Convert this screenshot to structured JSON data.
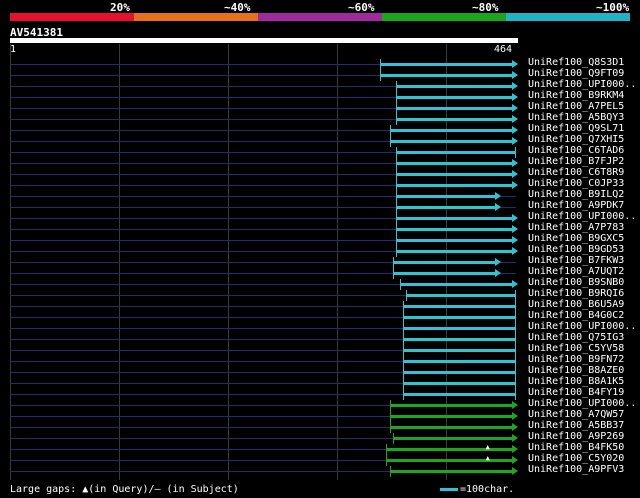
{
  "legend": {
    "segments": [
      {
        "label": "20%",
        "color": "#e8102f"
      },
      {
        "label": "~40%",
        "color": "#e8701a"
      },
      {
        "label": "~60%",
        "color": "#9e2a9e"
      },
      {
        "label": "~80%",
        "color": "#1aa51a"
      },
      {
        "label": "~100%",
        "color": "#1eb4c6"
      }
    ]
  },
  "query": {
    "name": "AV541381",
    "start": "1",
    "end": "464"
  },
  "hits": [
    {
      "label": "UniRef100_Q8S3D1",
      "start": 0.731,
      "color": "#2fc4d4",
      "arrow": true,
      "tick": true
    },
    {
      "label": "UniRef100_Q9FT09",
      "start": 0.731,
      "color": "#2fc4d4",
      "arrow": true,
      "tick": true
    },
    {
      "label": "UniRef100_UPI000..",
      "start": 0.762,
      "color": "#2fc4d4",
      "arrow": true,
      "tick": true
    },
    {
      "label": "UniRef100_B9RKM4",
      "start": 0.762,
      "color": "#2fc4d4",
      "arrow": true,
      "tick": true
    },
    {
      "label": "UniRef100_A7PEL5",
      "start": 0.762,
      "color": "#2fc4d4",
      "arrow": true,
      "tick": true
    },
    {
      "label": "UniRef100_A5BQY3",
      "start": 0.762,
      "color": "#2fc4d4",
      "arrow": true,
      "tick": true
    },
    {
      "label": "UniRef100_Q9SL71",
      "start": 0.75,
      "color": "#2fc4d4",
      "arrow": true,
      "tick": true
    },
    {
      "label": "UniRef100_Q7XHI5",
      "start": 0.75,
      "color": "#2fc4d4",
      "arrow": true,
      "tick": true
    },
    {
      "label": "UniRef100_C6TAD6",
      "start": 0.762,
      "color": "#2fc4d4",
      "arrow": false,
      "tick": true
    },
    {
      "label": "UniRef100_B7FJP2",
      "start": 0.762,
      "color": "#2fc4d4",
      "arrow": true,
      "tick": true
    },
    {
      "label": "UniRef100_C6T8R9",
      "start": 0.762,
      "color": "#2fc4d4",
      "arrow": true,
      "tick": true
    },
    {
      "label": "UniRef100_C0JP33",
      "start": 0.762,
      "color": "#2fc4d4",
      "arrow": true,
      "tick": true
    },
    {
      "label": "UniRef100_B9ILQ2",
      "start": 0.762,
      "end": 0.966,
      "color": "#2fc4d4",
      "arrow": true,
      "tick": true
    },
    {
      "label": "UniRef100_A9PDK7",
      "start": 0.762,
      "end": 0.966,
      "color": "#2fc4d4",
      "arrow": true,
      "tick": true
    },
    {
      "label": "UniRef100_UPI000..",
      "start": 0.762,
      "color": "#2fc4d4",
      "arrow": true,
      "tick": true
    },
    {
      "label": "UniRef100_A7P783",
      "start": 0.762,
      "color": "#2fc4d4",
      "arrow": true,
      "tick": true
    },
    {
      "label": "UniRef100_B9GXC5",
      "start": 0.762,
      "color": "#2fc4d4",
      "arrow": true,
      "tick": true
    },
    {
      "label": "UniRef100_B9GD53",
      "start": 0.762,
      "color": "#2fc4d4",
      "arrow": true,
      "tick": true
    },
    {
      "label": "UniRef100_B7FKW3",
      "start": 0.756,
      "end": 0.966,
      "color": "#2fc4d4",
      "arrow": true,
      "tick": true
    },
    {
      "label": "UniRef100_A7UQT2",
      "start": 0.756,
      "end": 0.966,
      "color": "#2fc4d4",
      "arrow": true,
      "tick": true
    },
    {
      "label": "UniRef100_B9SNB0",
      "start": 0.77,
      "color": "#2fc4d4",
      "arrow": true,
      "tick": true
    },
    {
      "label": "UniRef100_B9RQI6",
      "start": 0.782,
      "color": "#2fc4d4",
      "arrow": false,
      "tick": true
    },
    {
      "label": "UniRef100_B6U5A9",
      "start": 0.776,
      "color": "#2fc4d4",
      "arrow": false,
      "tick": true
    },
    {
      "label": "UniRef100_B4G0C2",
      "start": 0.776,
      "color": "#2fc4d4",
      "arrow": false,
      "tick": true
    },
    {
      "label": "UniRef100_UPI000..",
      "start": 0.776,
      "color": "#2fc4d4",
      "arrow": false,
      "tick": true
    },
    {
      "label": "UniRef100_Q75IG3",
      "start": 0.776,
      "color": "#2fc4d4",
      "arrow": false,
      "tick": true
    },
    {
      "label": "UniRef100_C5YV58",
      "start": 0.776,
      "color": "#2fc4d4",
      "arrow": false,
      "tick": true
    },
    {
      "label": "UniRef100_B9FN72",
      "start": 0.776,
      "color": "#2fc4d4",
      "arrow": false,
      "tick": true
    },
    {
      "label": "UniRef100_B8AZE0",
      "start": 0.776,
      "color": "#2fc4d4",
      "arrow": false,
      "tick": true
    },
    {
      "label": "UniRef100_B8A1K5",
      "start": 0.776,
      "color": "#2fc4d4",
      "arrow": false,
      "tick": true
    },
    {
      "label": "UniRef100_B4FY19",
      "start": 0.776,
      "color": "#2fc4d4",
      "arrow": false,
      "tick": true
    },
    {
      "label": "UniRef100_UPI000..",
      "start": 0.75,
      "color": "#1ea61e",
      "arrow": true,
      "tick": true
    },
    {
      "label": "UniRef100_A7QW57",
      "start": 0.75,
      "color": "#1ea61e",
      "arrow": true,
      "tick": true
    },
    {
      "label": "UniRef100_A5BB37",
      "start": 0.75,
      "color": "#1ea61e",
      "arrow": true,
      "tick": true
    },
    {
      "label": "UniRef100_A9P269",
      "start": 0.756,
      "color": "#1ea61e",
      "arrow": true,
      "tick": true
    },
    {
      "label": "UniRef100_B4FK50",
      "start": 0.744,
      "color": "#1ea61e",
      "arrow": true,
      "tick": true,
      "gap": 0.94
    },
    {
      "label": "UniRef100_C5Y020",
      "start": 0.744,
      "color": "#1ea61e",
      "arrow": true,
      "tick": true,
      "gap": 0.94
    },
    {
      "label": "UniRef100_A9PFV3",
      "start": 0.75,
      "color": "#1ea61e",
      "arrow": true,
      "tick": true
    }
  ],
  "footer": {
    "text": "Large gaps: ▲(in Query)/— (in Subject)",
    "scale": "=100char."
  }
}
